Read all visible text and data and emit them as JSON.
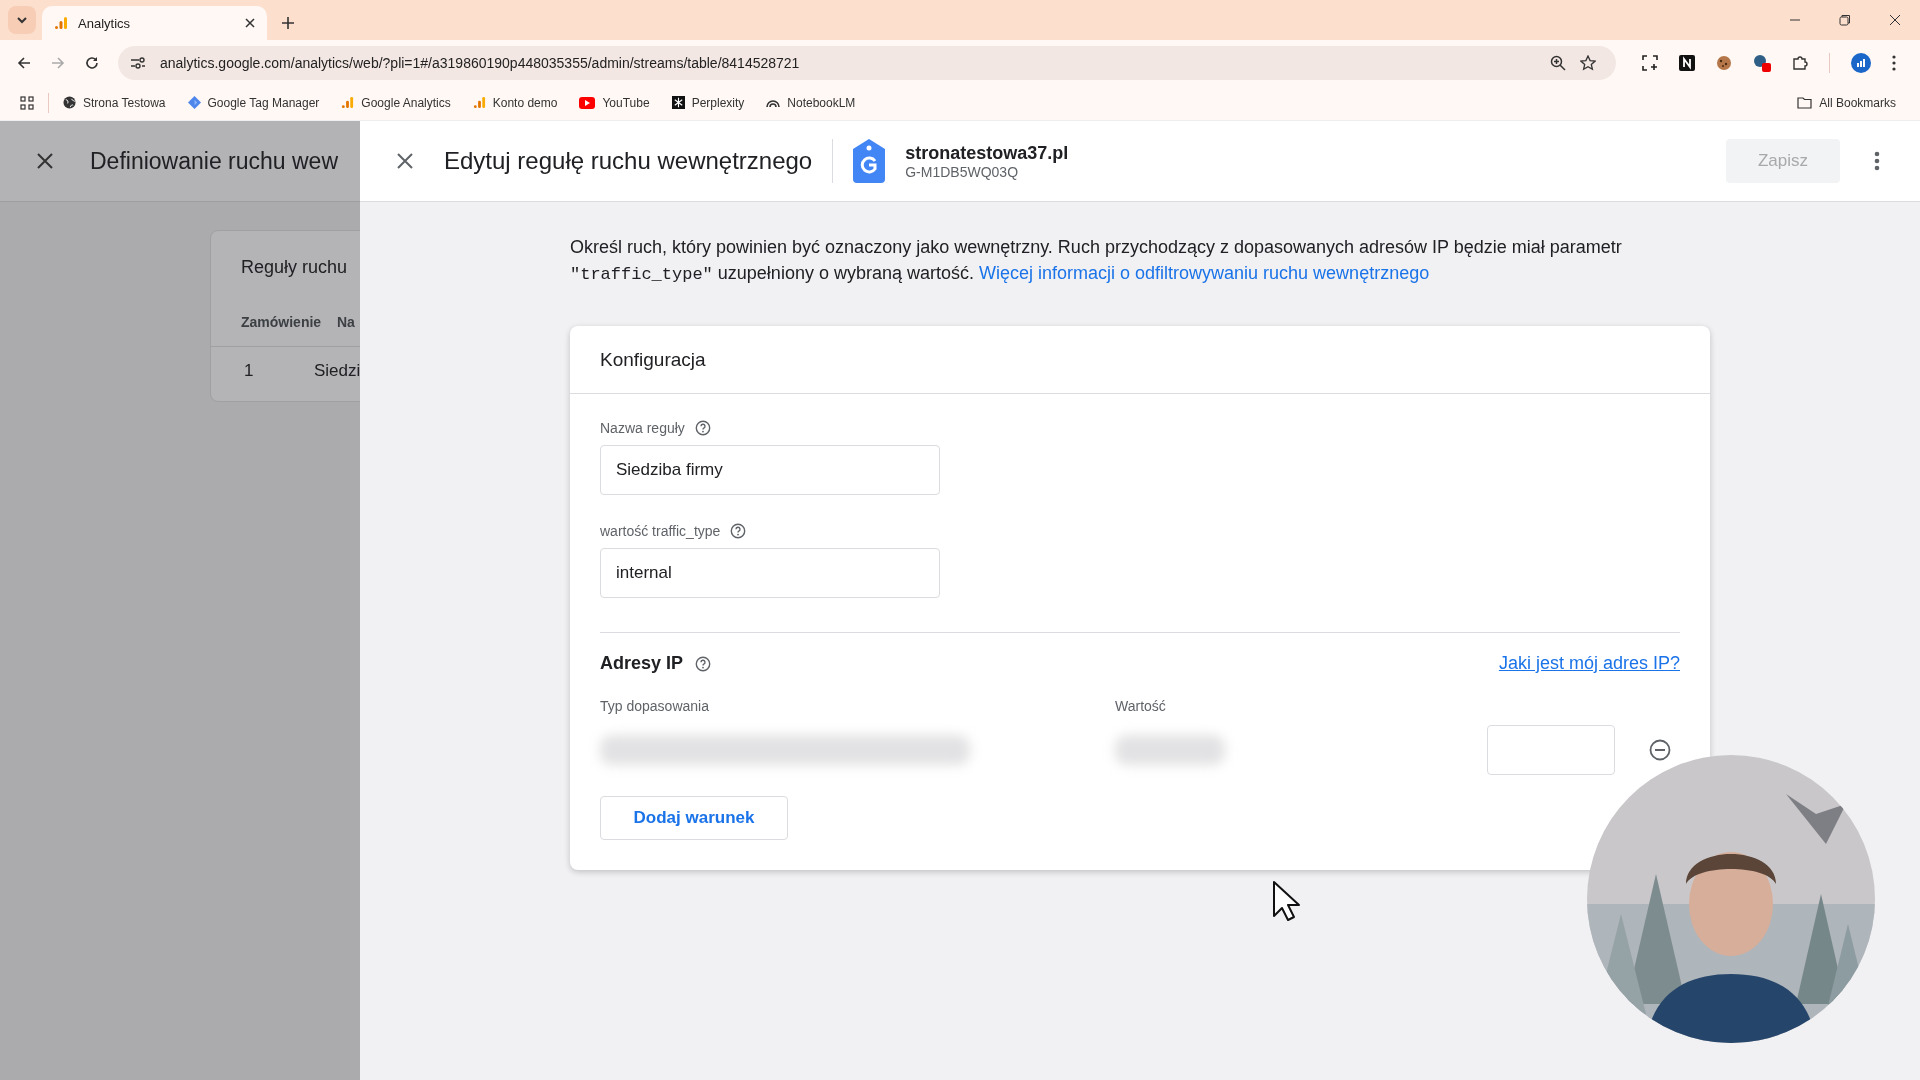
{
  "browser": {
    "tab": {
      "title": "Analytics",
      "selected": true
    },
    "url": "analytics.google.com/analytics/web/?pli=1#/a319860190p448035355/admin/streams/table/8414528721",
    "bookmarks": [
      {
        "label": "Strona Testowa",
        "kind": "globe"
      },
      {
        "label": "Google Tag Manager",
        "kind": "tagmanager"
      },
      {
        "label": "Google Analytics",
        "kind": "analytics"
      },
      {
        "label": "Konto demo",
        "kind": "analytics"
      },
      {
        "label": "YouTube",
        "kind": "youtube"
      },
      {
        "label": "Perplexity",
        "kind": "perplexity"
      },
      {
        "label": "NotebookLM",
        "kind": "notebook"
      }
    ],
    "all_bookmarks": "All Bookmarks"
  },
  "background_page": {
    "title": "Definiowanie ruchu wew",
    "card": {
      "title": "Reguły ruchu",
      "columns": [
        "Zamówienie",
        "Na"
      ],
      "rows": [
        {
          "cells": [
            "1",
            "Siedzi"
          ]
        }
      ]
    }
  },
  "drawer": {
    "title": "Edytuj regułę ruchu wewnętrznego",
    "property": {
      "name": "stronatestowa37.pl",
      "id": "G-M1DB5WQ03Q"
    },
    "save_button": {
      "label": "Zapisz",
      "disabled": true
    },
    "intro": {
      "before": "Określ ruch, który powinien być oznaczony jako wewnętrzny. Ruch przychodzący z dopasowanych adresów IP będzie miał parametr ",
      "code": "\"traffic_type\"",
      "after": " uzupełniony o wybraną wartość. ",
      "link": "Więcej informacji o odfiltrowywaniu ruchu wewnętrznego"
    },
    "config": {
      "title": "Konfiguracja",
      "fields": [
        {
          "label": "Nazwa reguły",
          "value": "Siedziba firmy"
        },
        {
          "label": "wartość traffic_type",
          "value": "internal"
        }
      ],
      "ip_section": {
        "title": "Adresy IP",
        "link": "Jaki jest mój adres IP?",
        "columns": [
          "Typ dopasowania",
          "Wartość"
        ],
        "add_button": "Dodaj warunek"
      }
    }
  }
}
